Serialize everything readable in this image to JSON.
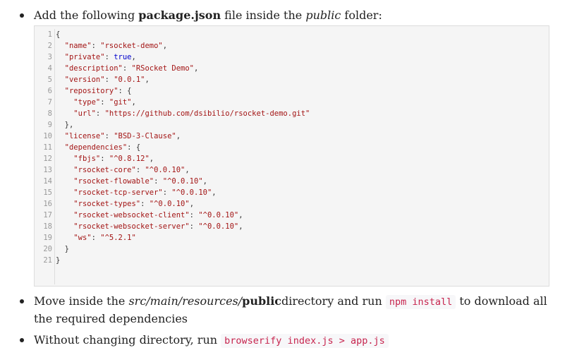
{
  "bullet1": {
    "prefix": "Add the following ",
    "filename": "package.json",
    "middle": " file inside the ",
    "folder": "public",
    "suffix": " folder:"
  },
  "code_lines": [
    "{",
    "  \"name\": \"rsocket-demo\",",
    "  \"private\": true,",
    "  \"description\": \"RSocket Demo\",",
    "  \"version\": \"0.0.1\",",
    "  \"repository\": {",
    "    \"type\": \"git\",",
    "    \"url\": \"https://github.com/dsibilio/rsocket-demo.git\"",
    "  },",
    "  \"license\": \"BSD-3-Clause\",",
    "  \"dependencies\": {",
    "    \"fbjs\": \"^0.8.12\",",
    "    \"rsocket-core\": \"^0.0.10\",",
    "    \"rsocket-flowable\": \"^0.0.10\",",
    "    \"rsocket-tcp-server\": \"^0.0.10\",",
    "    \"rsocket-types\": \"^0.0.10\",",
    "    \"rsocket-websocket-client\": \"^0.0.10\",",
    "    \"rsocket-websocket-server\": \"^0.0.10\",",
    "    \"ws\": \"^5.2.1\"",
    "  }",
    "}"
  ],
  "bullet2": {
    "prefix": "Move inside the ",
    "path": "src/main/resources/",
    "dir": "public",
    "middle": "directory and run ",
    "code": "npm install",
    "suffix": " to download all the required dependencies"
  },
  "bullet3": {
    "prefix": "Without changing directory, run ",
    "code": "browserify index.js > app.js"
  }
}
